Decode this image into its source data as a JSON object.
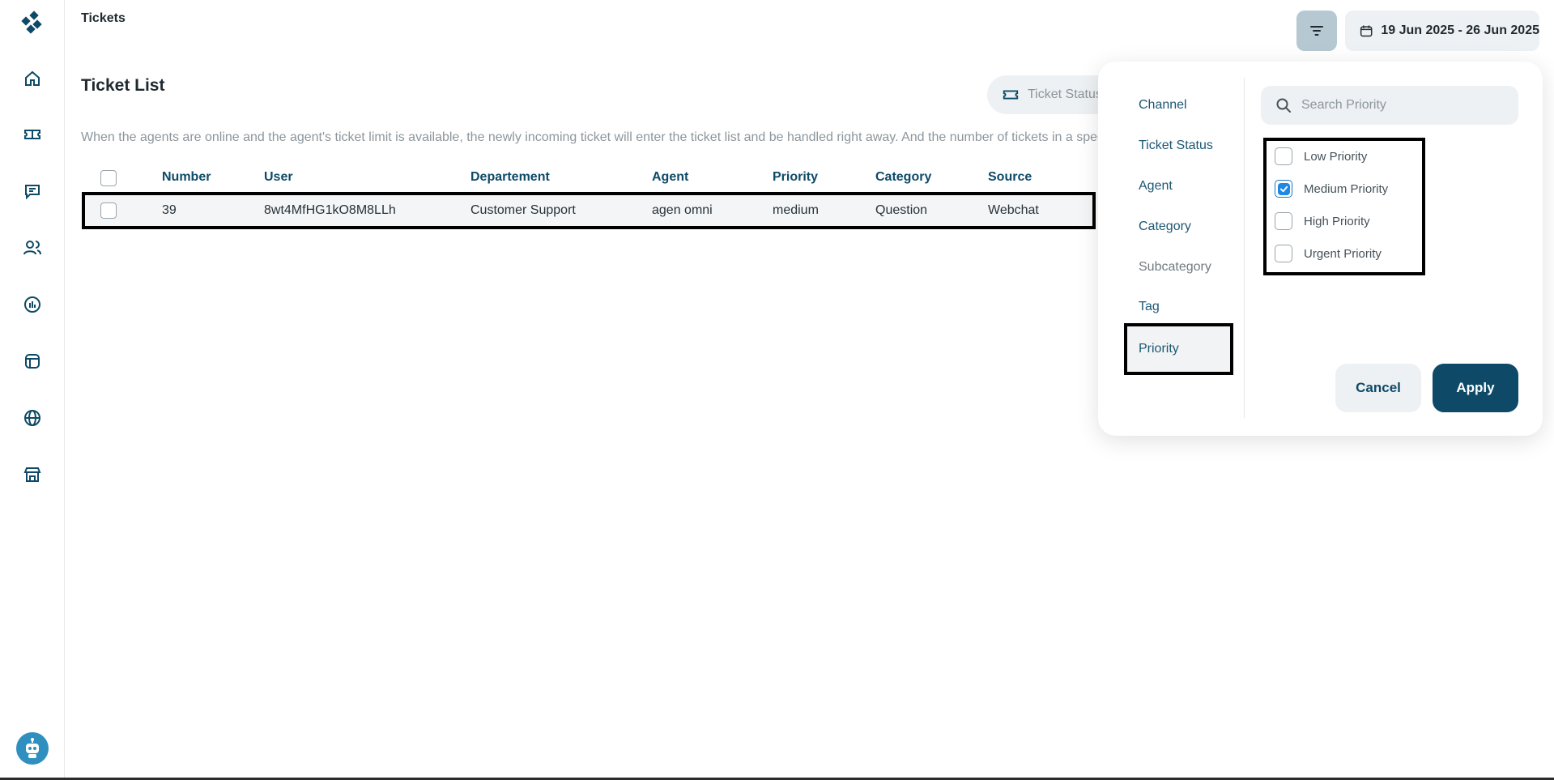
{
  "header": {
    "page_title": "Tickets",
    "date_range": "19 Jun 2025 - 26 Jun 2025"
  },
  "sidebar": {
    "icons": [
      "home-icon",
      "ticket-icon",
      "chat-icon",
      "users-icon",
      "report-icon",
      "template-icon",
      "globe-icon",
      "store-icon"
    ]
  },
  "main": {
    "title": "Ticket List",
    "status_chip": "Ticket Status",
    "info_text": "When the agents are online and the agent's ticket limit is available, the newly incoming ticket will enter the ticket list and be handled right away. And the number of tickets in a specifi",
    "columns": {
      "number": "Number",
      "user": "User",
      "department": "Departement",
      "agent": "Agent",
      "priority": "Priority",
      "category": "Category",
      "source": "Source"
    },
    "rows": [
      {
        "number": "39",
        "user": "8wt4MfHG1kO8M8LLh",
        "department": "Customer Support",
        "agent": "agen omni",
        "priority": "medium",
        "category": "Question",
        "source": "Webchat"
      }
    ]
  },
  "filter": {
    "categories": [
      "Channel",
      "Ticket Status",
      "Agent",
      "Category",
      "Subcategory",
      "Tag",
      "Priority"
    ],
    "active_category": "Priority",
    "search_placeholder": "Search Priority",
    "options": [
      {
        "label": "Low Priority",
        "checked": false
      },
      {
        "label": "Medium Priority",
        "checked": true
      },
      {
        "label": "High Priority",
        "checked": false
      },
      {
        "label": "Urgent Priority",
        "checked": false
      }
    ],
    "cancel_label": "Cancel",
    "apply_label": "Apply"
  },
  "colors": {
    "brand": "#0e4a67",
    "filter_button": "#b6c8d2",
    "checkbox_checked": "#1e88e5"
  }
}
